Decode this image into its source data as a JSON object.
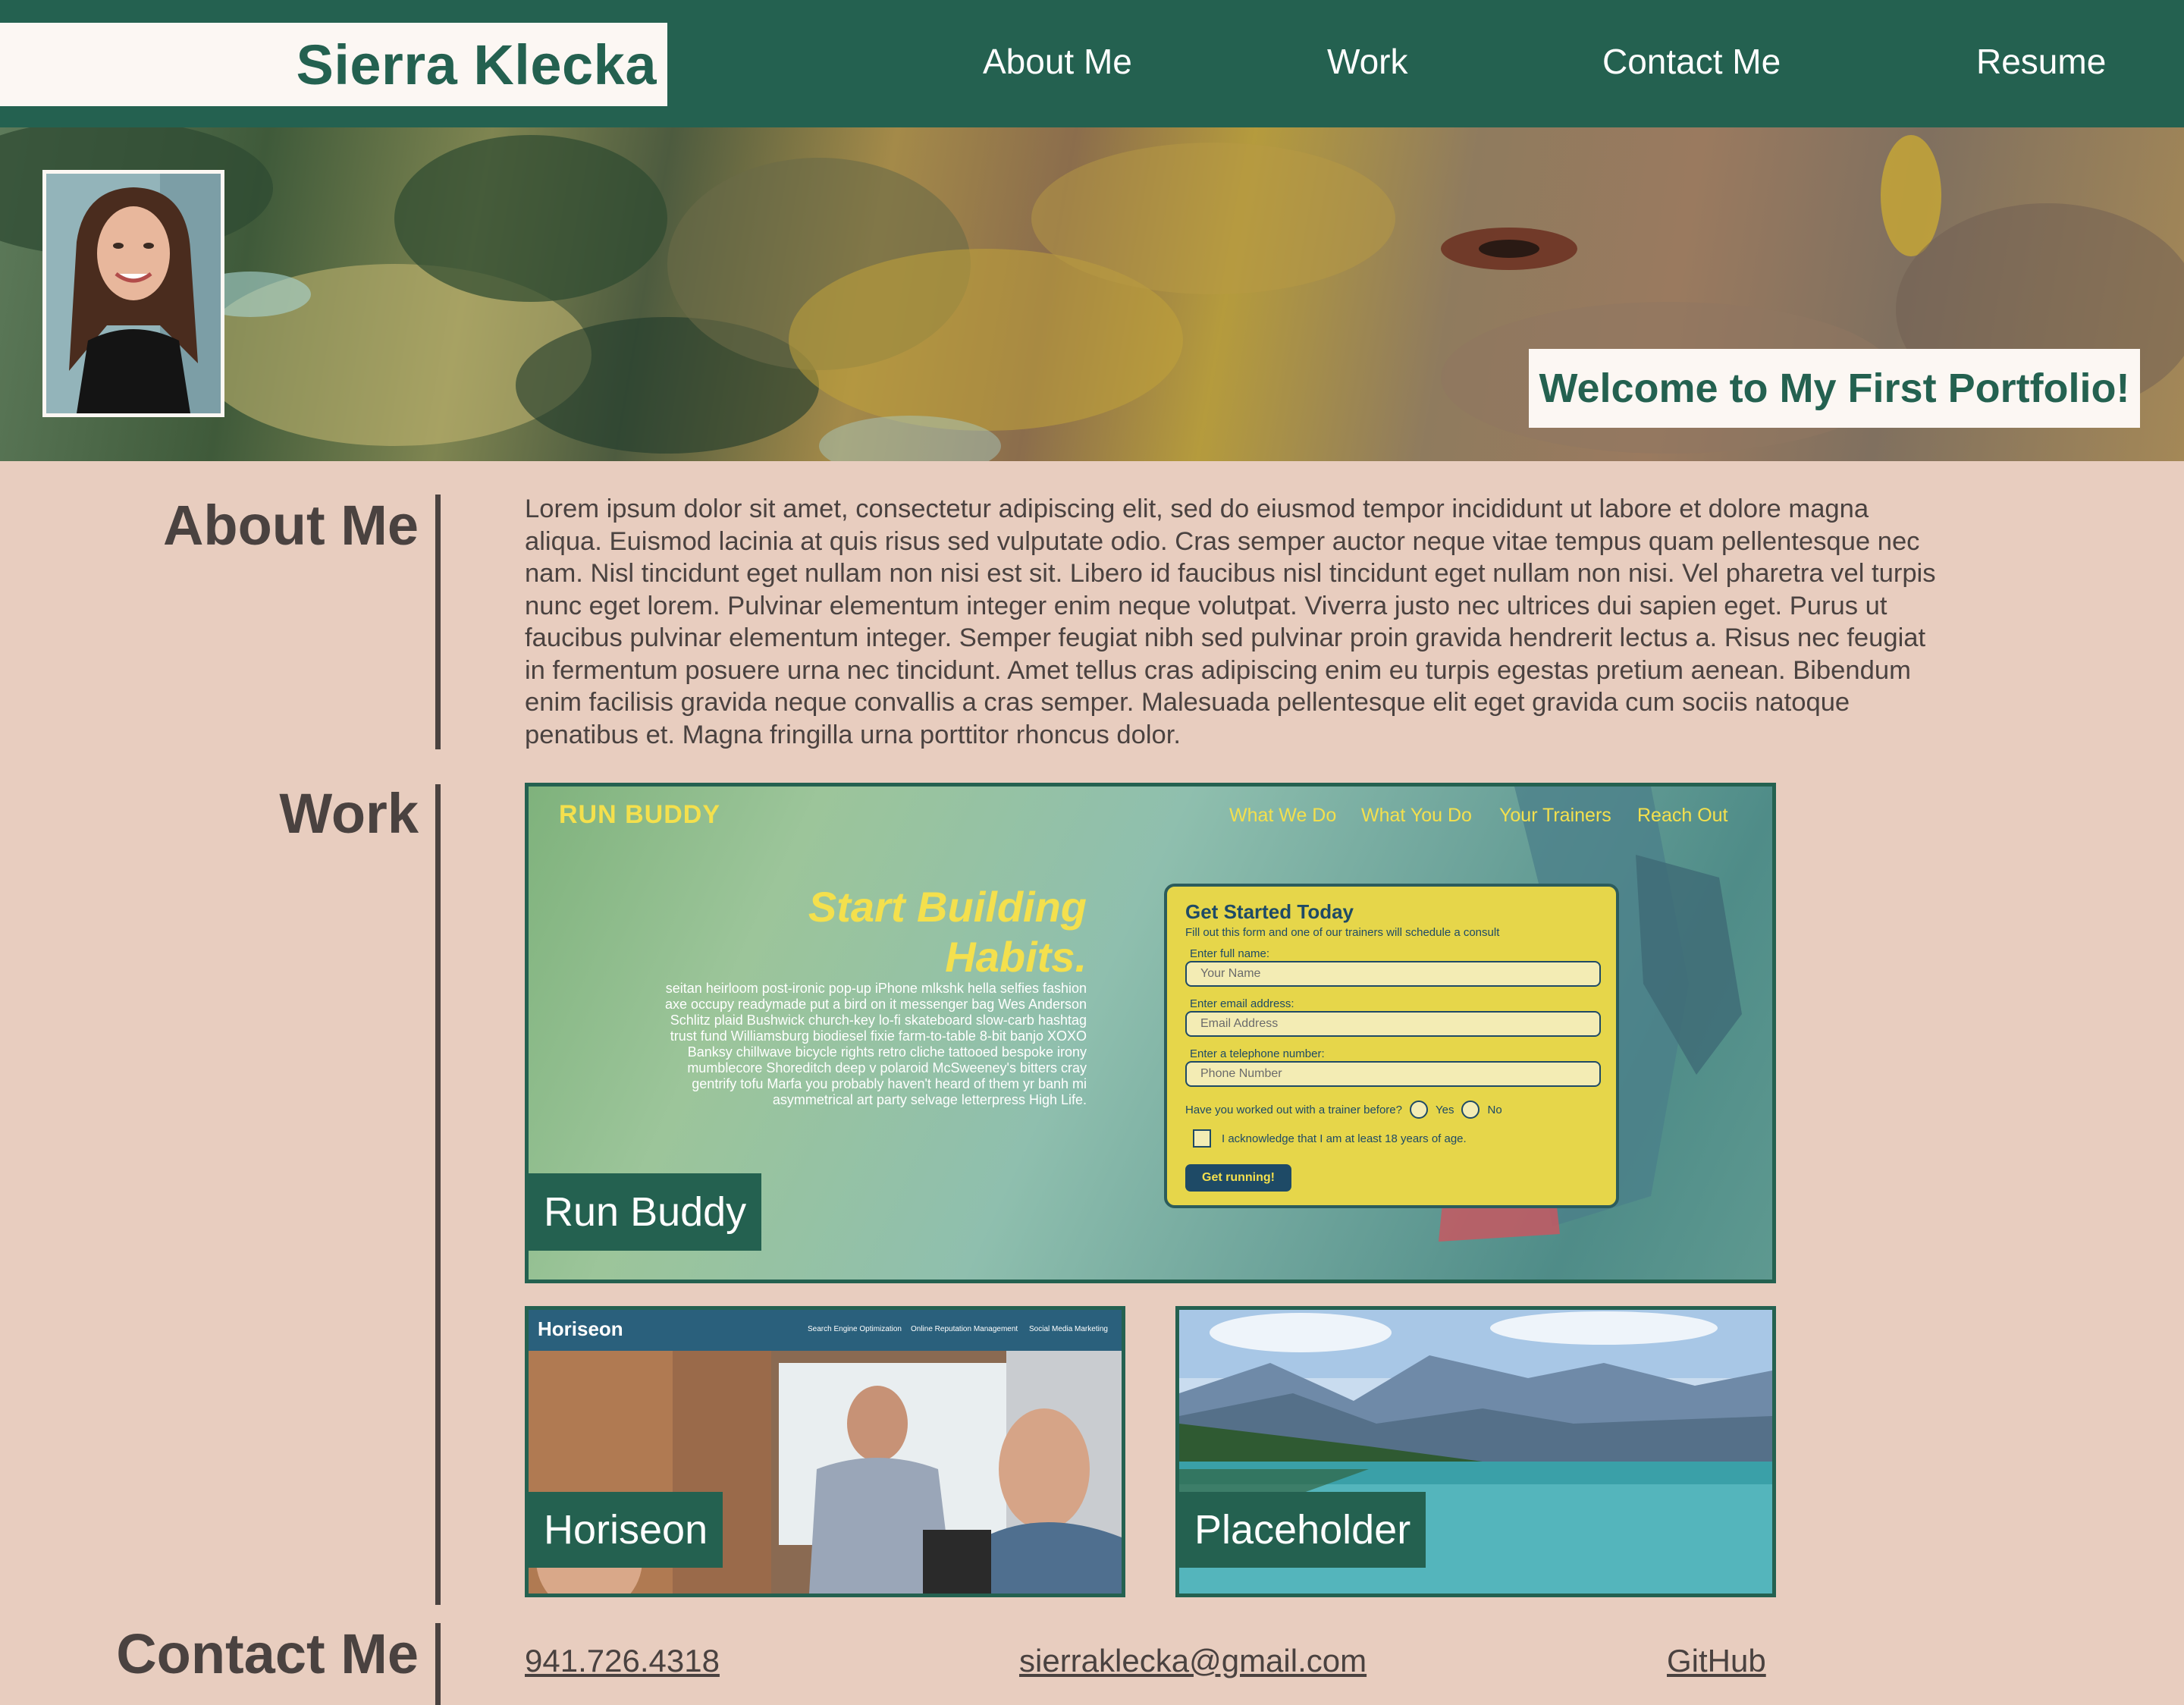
{
  "header": {
    "brand": "Sierra Klecka",
    "nav": [
      "About Me",
      "Work",
      "Contact Me",
      "Resume"
    ]
  },
  "hero": {
    "welcome": "Welcome to My First Portfolio!"
  },
  "about": {
    "title": "About Me",
    "text": "Lorem ipsum dolor sit amet, consectetur adipiscing elit, sed do eiusmod tempor incididunt ut labore et dolore magna aliqua. Euismod lacinia at quis risus sed vulputate odio. Cras semper auctor neque vitae tempus quam pellentesque nec nam. Nisl tincidunt eget nullam non nisi est sit. Libero id faucibus nisl tincidunt eget nullam non nisi. Vel pharetra vel turpis nunc eget lorem. Pulvinar elementum integer enim neque volutpat. Viverra justo nec ultrices dui sapien eget. Purus ut faucibus pulvinar elementum integer. Semper feugiat nibh sed pulvinar proin gravida hendrerit lectus a. Risus nec feugiat in fermentum posuere urna nec tincidunt. Amet tellus cras adipiscing enim eu turpis egestas pretium aenean. Bibendum enim facilisis gravida neque convallis a cras semper. Malesuada pellentesque elit eget gravida cum sociis natoque penatibus et. Magna fringilla urna porttitor rhoncus dolor."
  },
  "work": {
    "title": "Work",
    "projects": [
      {
        "label": "Run Buddy",
        "screenshot": {
          "logo": "RUN BUDDY",
          "nav": [
            "What We Do",
            "What You Do",
            "Your Trainers",
            "Reach Out"
          ],
          "headline_1": "Start Building",
          "headline_2": "Habits.",
          "body": "seitan heirloom post-ironic pop-up iPhone mlkshk hella selfies fashion axe occupy readymade put a bird on it messenger bag Wes Anderson Schlitz plaid Bushwick church-key lo-fi skateboard slow-carb hashtag trust fund Williamsburg biodiesel fixie farm-to-table 8-bit banjo XOXO Banksy chillwave bicycle rights retro cliche tattooed bespoke irony mumblecore Shoreditch deep v polaroid McSweeney's bitters cray gentrify tofu Marfa you probably haven't heard of them yr banh mi asymmetrical art party selvage letterpress High Life.",
          "form_title": "Get Started Today",
          "form_subtitle": "Fill out this form and one of our trainers will schedule a consult",
          "name_label": "Enter full name:",
          "name_placeholder": "Your Name",
          "email_label": "Enter email address:",
          "email_placeholder": "Email Address",
          "phone_label": "Enter a telephone number:",
          "phone_placeholder": "Phone Number",
          "trainer_question": "Have you worked out with a trainer before?",
          "yes": "Yes",
          "no": "No",
          "acknowledge": "I acknowledge that I am at least 18 years of age.",
          "button": "Get running!"
        }
      },
      {
        "label": "Horiseon",
        "screenshot": {
          "logo": "Horiseon",
          "nav": [
            "Search Engine Optimization",
            "Online Reputation Management",
            "Social Media Marketing"
          ]
        }
      },
      {
        "label": "Placeholder"
      }
    ]
  },
  "contact": {
    "title": "Contact Me",
    "phone": "941.726.4318",
    "email": "sierraklecka@gmail.com",
    "github": "GitHub"
  }
}
